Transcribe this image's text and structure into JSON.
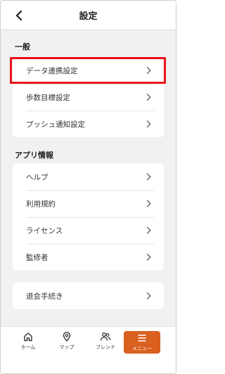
{
  "header": {
    "title": "設定"
  },
  "sections": {
    "general": {
      "title": "一般",
      "items": [
        {
          "label": "データ連携設定"
        },
        {
          "label": "歩数目標設定"
        },
        {
          "label": "プッシュ通知設定"
        }
      ]
    },
    "app_info": {
      "title": "アプリ情報",
      "items": [
        {
          "label": "ヘルプ"
        },
        {
          "label": "利用規約"
        },
        {
          "label": "ライセンス"
        },
        {
          "label": "監修者"
        }
      ]
    },
    "account": {
      "items": [
        {
          "label": "退会手続き"
        }
      ]
    }
  },
  "tabbar": {
    "tabs": [
      {
        "label": "ホーム",
        "icon": "home-icon"
      },
      {
        "label": "マップ",
        "icon": "map-pin-icon"
      },
      {
        "label": "フレンド",
        "icon": "friends-icon"
      },
      {
        "label": "メニュー",
        "icon": "menu-icon",
        "active": true
      }
    ]
  },
  "colors": {
    "accent": "#d9601f",
    "highlight": "#e8121b"
  }
}
